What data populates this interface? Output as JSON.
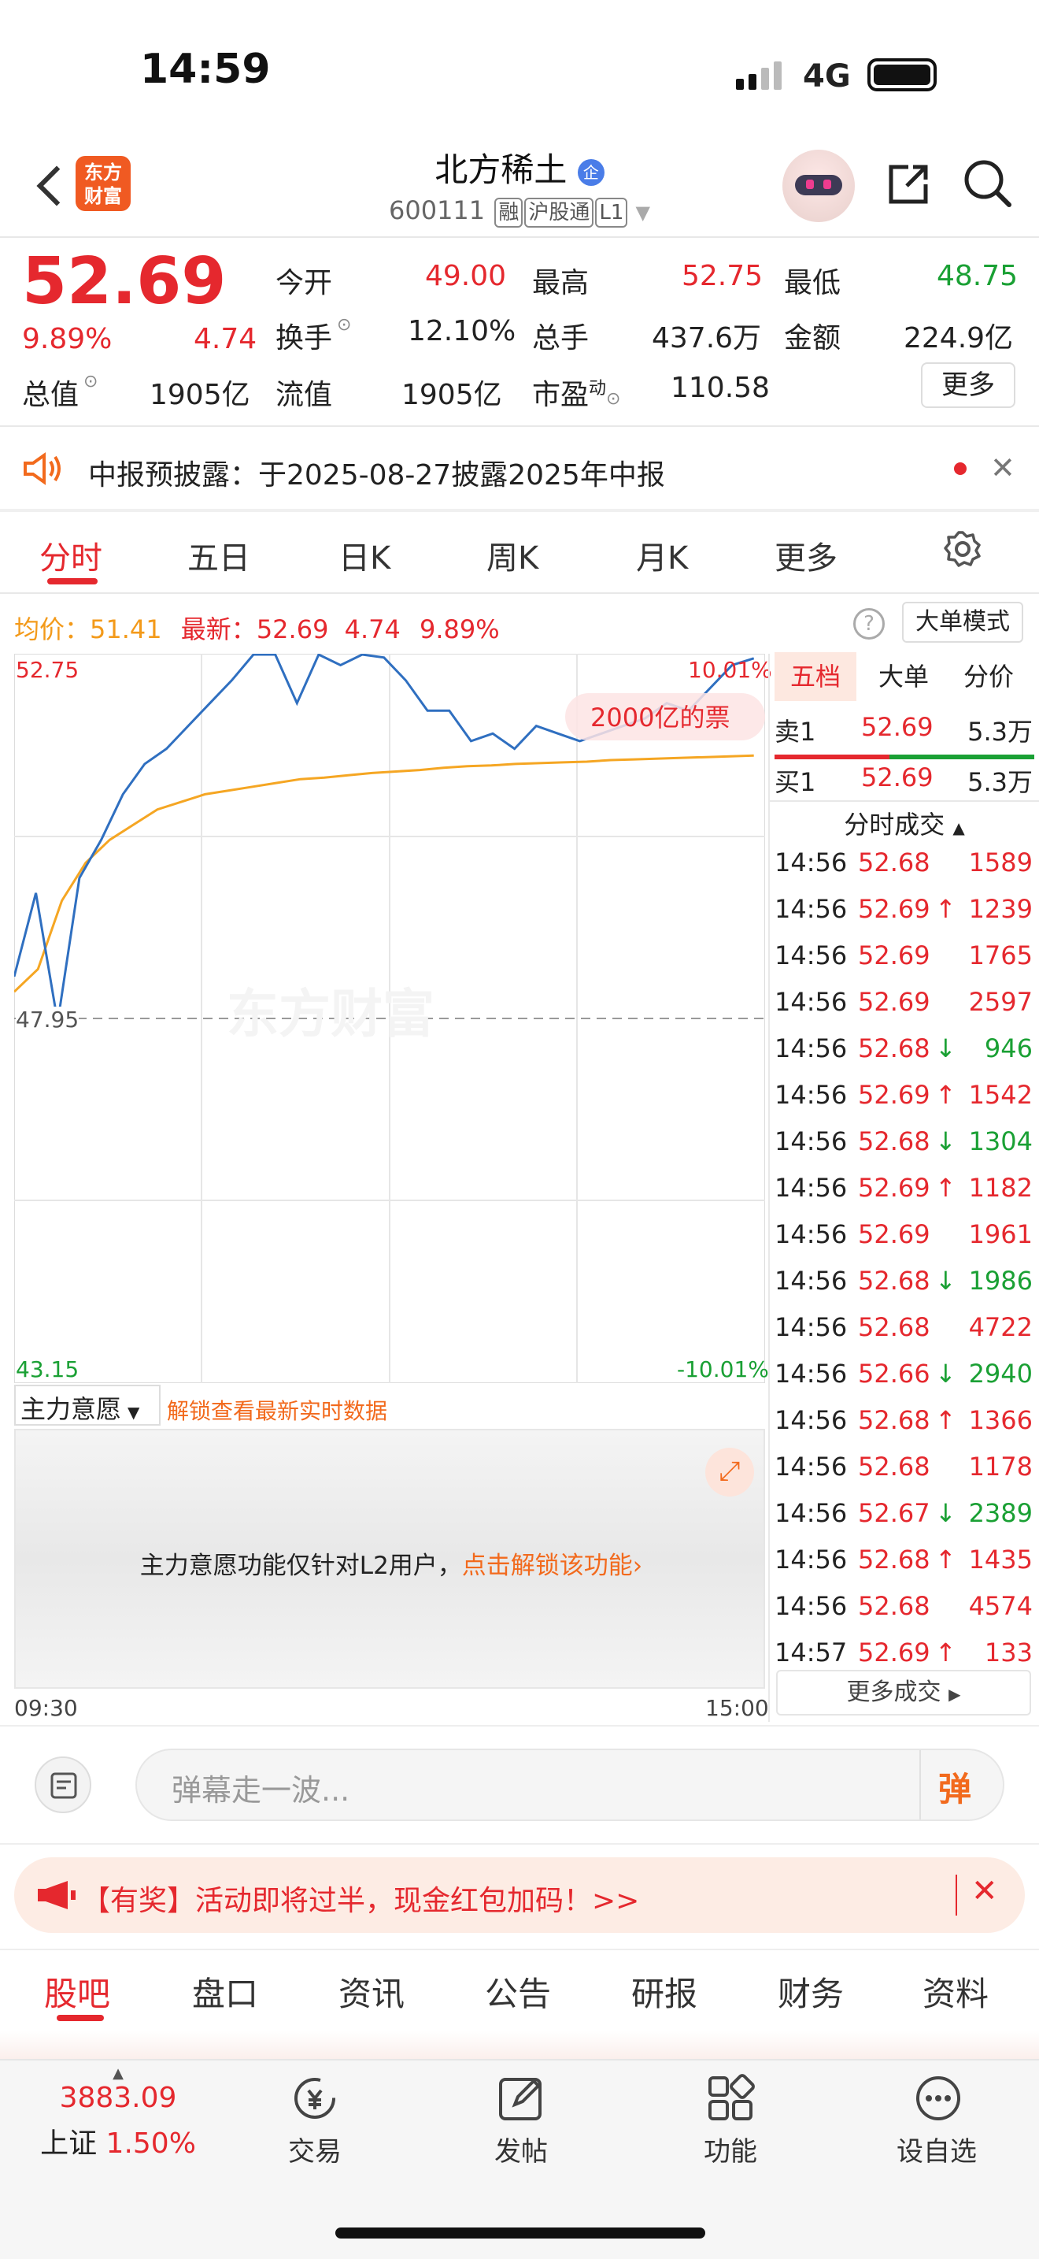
{
  "status": {
    "time": "14:59",
    "network": "4G"
  },
  "header": {
    "logo": "东方\n财富",
    "title": "北方稀土",
    "code": "600111",
    "tags": [
      "融",
      "沪股通",
      "L1"
    ]
  },
  "quote": {
    "price": "52.69",
    "pct": "9.89%",
    "chg": "4.74",
    "open_l": "今开",
    "open": "49.00",
    "high_l": "最高",
    "high": "52.75",
    "low_l": "最低",
    "low": "48.75",
    "turn_l": "换手",
    "turn": "12.10%",
    "vol_l": "总手",
    "vol": "437.6万",
    "amt_l": "金额",
    "amt": "224.9亿",
    "mcap_l": "总值",
    "mcap": "1905亿",
    "float_l": "流值",
    "float": "1905亿",
    "pe_l": "市盈",
    "pe_sup": "动",
    "pe": "110.58",
    "more": "更多"
  },
  "notice": {
    "text": "中报预披露：于2025-08-27披露2025年中报"
  },
  "tabs": [
    "分时",
    "五日",
    "日K",
    "周K",
    "月K",
    "更多"
  ],
  "chart_info": {
    "avg_l": "均价：",
    "avg": "51.41",
    "last_l": "最新：",
    "last": "52.69",
    "chg": "4.74",
    "pct": "9.89%",
    "mode": "大单模式"
  },
  "chart_data": {
    "type": "line",
    "ymax_label": "52.75",
    "ymin_label": "43.15",
    "mid_label": "47.95",
    "pct_top": "10.01%",
    "pct_bot": "-10.01%",
    "x_start": "09:30",
    "x_end": "15:00",
    "watermark": "东方财富",
    "bubble": "2000亿的票 ",
    "ylim": [
      43.15,
      52.75
    ],
    "prev_close": 47.95,
    "series": [
      {
        "values": [
          48.5,
          49.6,
          47.9,
          49.8,
          50.3,
          50.9,
          51.3,
          51.5,
          51.8,
          52.1,
          52.4,
          52.75,
          52.75,
          52.1,
          52.75,
          52.6,
          52.75,
          52.7,
          52.4,
          52.0,
          52.0,
          51.6,
          51.7,
          51.5,
          51.8,
          51.7,
          51.6,
          51.7,
          51.8,
          51.9,
          52.1,
          52.0,
          52.3,
          52.6,
          52.69
        ]
      },
      {
        "values": [
          48.3,
          48.6,
          49.5,
          50.0,
          50.3,
          50.5,
          50.7,
          50.8,
          50.9,
          50.95,
          51.0,
          51.05,
          51.1,
          51.12,
          51.15,
          51.18,
          51.2,
          51.22,
          51.25,
          51.27,
          51.28,
          51.3,
          51.31,
          51.32,
          51.33,
          51.35,
          51.36,
          51.37,
          51.38,
          51.39,
          51.4,
          51.41
        ]
      }
    ]
  },
  "book": {
    "tabs": [
      "五档",
      "大单",
      "分价"
    ],
    "sell_l": "卖1",
    "sell_p": "52.69",
    "sell_v": "5.3万",
    "buy_l": "买1",
    "buy_p": "52.69",
    "buy_v": "5.3万",
    "tick_title": "分时成交",
    "more": "更多成交"
  },
  "ticks": [
    {
      "t": "14:56",
      "p": "52.68",
      "d": "",
      "v": "1589"
    },
    {
      "t": "14:56",
      "p": "52.69",
      "d": "↑",
      "v": "1239"
    },
    {
      "t": "14:56",
      "p": "52.69",
      "d": "",
      "v": "1765"
    },
    {
      "t": "14:56",
      "p": "52.69",
      "d": "",
      "v": "2597"
    },
    {
      "t": "14:56",
      "p": "52.68",
      "d": "↓",
      "v": "946"
    },
    {
      "t": "14:56",
      "p": "52.69",
      "d": "↑",
      "v": "1542"
    },
    {
      "t": "14:56",
      "p": "52.68",
      "d": "↓",
      "v": "1304"
    },
    {
      "t": "14:56",
      "p": "52.69",
      "d": "↑",
      "v": "1182"
    },
    {
      "t": "14:56",
      "p": "52.69",
      "d": "",
      "v": "1961"
    },
    {
      "t": "14:56",
      "p": "52.68",
      "d": "↓",
      "v": "1986"
    },
    {
      "t": "14:56",
      "p": "52.68",
      "d": "",
      "v": "4722"
    },
    {
      "t": "14:56",
      "p": "52.66",
      "d": "↓",
      "v": "2940"
    },
    {
      "t": "14:56",
      "p": "52.68",
      "d": "↑",
      "v": "1366"
    },
    {
      "t": "14:56",
      "p": "52.68",
      "d": "",
      "v": "1178"
    },
    {
      "t": "14:56",
      "p": "52.67",
      "d": "↓",
      "v": "2389"
    },
    {
      "t": "14:56",
      "p": "52.68",
      "d": "↑",
      "v": "1435"
    },
    {
      "t": "14:56",
      "p": "52.68",
      "d": "",
      "v": "4574"
    },
    {
      "t": "14:57",
      "p": "52.69",
      "d": "↑",
      "v": "133"
    }
  ],
  "main_force": {
    "label": "主力意愿",
    "lock": "解锁查看最新实时数据",
    "msg": "主力意愿功能仅针对L2用户，",
    "link": "点击解锁该功能"
  },
  "danmu": {
    "placeholder": "弹幕走一波...",
    "btn": "弹"
  },
  "promo": {
    "text": "【有奖】活动即将过半，现金红包加码！>>"
  },
  "page_tabs": [
    "股吧",
    "盘口",
    "资讯",
    "公告",
    "研报",
    "财务",
    "资料"
  ],
  "bottom": {
    "index_val": "3883.09",
    "index_name": "上证",
    "index_pct": "1.50%",
    "items": [
      "交易",
      "发帖",
      "功能",
      "设自选"
    ]
  }
}
